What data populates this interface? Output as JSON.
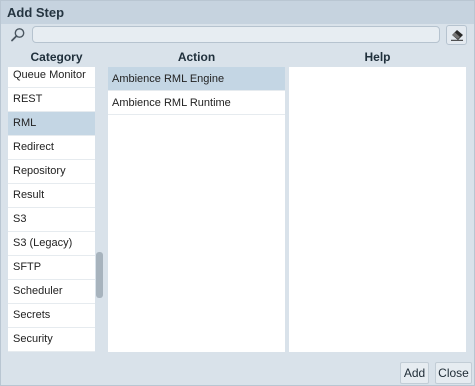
{
  "dialog": {
    "title": "Add Step"
  },
  "search": {
    "value": "",
    "placeholder": ""
  },
  "columns": {
    "category": "Category",
    "action": "Action",
    "help": "Help"
  },
  "categories": [
    {
      "label": "Queue Monitor"
    },
    {
      "label": "REST"
    },
    {
      "label": "RML"
    },
    {
      "label": "Redirect"
    },
    {
      "label": "Repository"
    },
    {
      "label": "Result"
    },
    {
      "label": "S3"
    },
    {
      "label": "S3 (Legacy)"
    },
    {
      "label": "SFTP"
    },
    {
      "label": "Scheduler"
    },
    {
      "label": "Secrets"
    },
    {
      "label": "Security"
    }
  ],
  "selected_category": "RML",
  "actions": [
    {
      "label": "Ambience RML Engine"
    },
    {
      "label": "Ambience RML Runtime"
    }
  ],
  "selected_action": "Ambience RML Engine",
  "buttons": {
    "add": "Add",
    "close": "Close"
  },
  "icons": {
    "search": "search-icon",
    "clear": "eraser-icon"
  },
  "colors": {
    "selection": "#c4d6e4",
    "titlebar": "#c6d3df",
    "background": "#d9e2ea"
  }
}
